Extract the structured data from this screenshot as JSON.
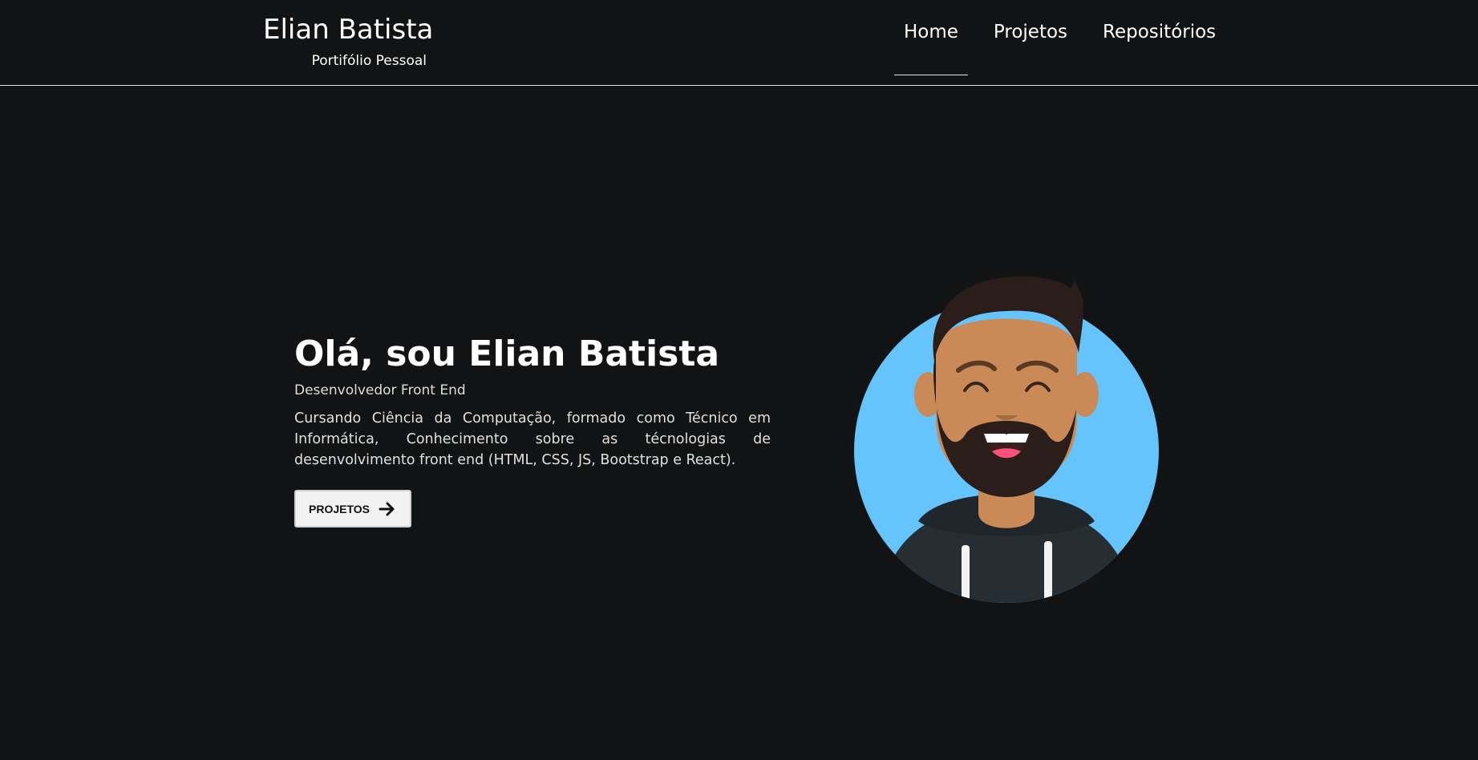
{
  "brand": {
    "title": "Elian Batista",
    "subtitle": "Portifólio Pessoal"
  },
  "nav": {
    "items": [
      {
        "label": "Home",
        "active": true
      },
      {
        "label": "Projetos",
        "active": false
      },
      {
        "label": "Repositórios",
        "active": false
      }
    ]
  },
  "hero": {
    "title": "Olá, sou Elian Batista",
    "role": "Desenvolvedor Front End",
    "description": "Cursando Ciência da Computação, formado como Técnico em Informática, Conhecimento sobre as técnologias de desenvolvimento front end (HTML, CSS, JS, Bootstrap e React).",
    "button_label": "PROJETOS",
    "button_icon": "arrow-right-icon"
  },
  "avatar": {
    "icon": "avatar-illustration",
    "background_color": "#64c4fb"
  },
  "colors": {
    "page_background": "#121314",
    "text": "#ffffff"
  }
}
